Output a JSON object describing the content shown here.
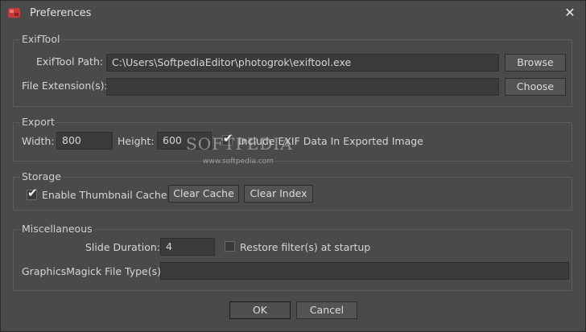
{
  "window": {
    "title": "Preferences"
  },
  "exiftool": {
    "group_title": "ExifTool",
    "path_label": "ExifTool Path:",
    "path_value": "C:\\Users\\SoftpediaEditor\\photogrok\\exiftool.exe",
    "browse_label": "Browse",
    "ext_label": "File Extension(s):",
    "ext_value": "",
    "choose_label": "Choose"
  },
  "export": {
    "group_title": "Export",
    "width_label": "Width:",
    "width_value": "800",
    "height_label": "Height:",
    "height_value": "600",
    "include_exif_label": "Include EXIF Data In Exported Image",
    "include_exif_checked": true
  },
  "storage": {
    "group_title": "Storage",
    "thumbnail_cache_label": "Enable Thumbnail Cache",
    "thumbnail_cache_checked": true,
    "clear_cache_label": "Clear Cache",
    "clear_index_label": "Clear Index"
  },
  "misc": {
    "group_title": "Miscellaneous",
    "slide_duration_label": "Slide Duration:",
    "slide_duration_value": "4",
    "restore_filters_label": "Restore filter(s) at startup",
    "restore_filters_checked": false,
    "gm_types_label": "GraphicsMagick File Type(s):",
    "gm_types_value": ""
  },
  "footer": {
    "ok_label": "OK",
    "cancel_label": "Cancel"
  },
  "watermark": {
    "brand": "SOFTPEDIA",
    "url": "www.softpedia.com"
  },
  "icons": {
    "app": "app-logo-icon",
    "close": "close-icon",
    "check": "checkmark-icon"
  },
  "colors": {
    "background": "#4a4a4a",
    "input_bg": "#3b3b3b",
    "button_bg": "#535353",
    "text": "#d6d6d6"
  }
}
